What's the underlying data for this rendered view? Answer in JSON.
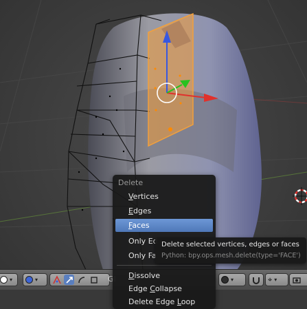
{
  "app": "Blender",
  "viewport": {
    "mesh_object": "selected mesh (edit mode, face select)",
    "selected_face_color": "#f29d3a",
    "gizmo": {
      "x_axis_color": "#e0312c",
      "y_axis_color": "#26c21f",
      "z_axis_color": "#3858e0"
    },
    "3d_cursor_icon": "3d-cursor-icon"
  },
  "delete_menu": {
    "title": "Delete",
    "items": [
      {
        "label": "Vertices",
        "underline": "V"
      },
      {
        "label": "Edges",
        "underline": "E"
      },
      {
        "label": "Faces",
        "underline": "F",
        "highlighted": true
      },
      {
        "label": "Only Edges & Faces",
        "visible_text": "Only Ed"
      },
      {
        "label": "Only Faces",
        "visible_text": "Only Fa"
      },
      {
        "label": "Dissolve",
        "underline": "D"
      },
      {
        "label": "Edge Collapse",
        "underline": "C"
      },
      {
        "label": "Delete Edge Loop",
        "underline": "L"
      }
    ]
  },
  "tooltip": {
    "title": "Delete selected vertices, edges or faces",
    "python": "Python: bpy.ops.mesh.delete(type='FACE')"
  },
  "header": {
    "pivot_icon": "pivot-point-icon",
    "transform_orientation_label": "Global",
    "visible_label": "Gl",
    "manipulator_icons": [
      "manipulator-toggle-icon",
      "translate-icon",
      "rotate-icon",
      "scale-icon"
    ],
    "right_icons": [
      "proportional-edit-icon",
      "snap-magnet-icon",
      "snap-target-icon",
      "render-camera-icon"
    ]
  }
}
